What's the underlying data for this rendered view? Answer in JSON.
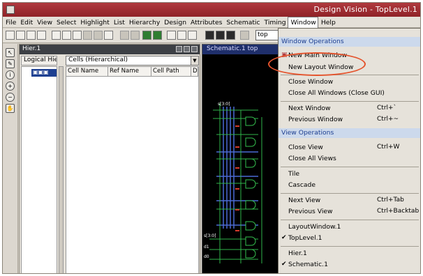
{
  "window": {
    "title": "Design Vision - TopLevel.1"
  },
  "menubar": [
    "File",
    "Edit",
    "View",
    "Select",
    "Highlight",
    "List",
    "Hierarchy",
    "Design",
    "Attributes",
    "Schematic",
    "Timing",
    "Window",
    "Help"
  ],
  "toolbar": {
    "combo_value": "top"
  },
  "hier_panel": {
    "title": "Hier.1",
    "tab_label": "Logical Hie",
    "tree_item": "▣▣▣",
    "cells_dropdown": "Cells (Hierarchical)",
    "columns": [
      "Cell Name",
      "Ref Name",
      "Cell Path",
      "D"
    ]
  },
  "schematic": {
    "title": "Schematic.1  top",
    "labels": {
      "in_a": "s[3:0]",
      "in_b": "d1",
      "in_c": "d0",
      "top_net": "s[3:0]"
    }
  },
  "window_menu": {
    "section_window_ops": "Window Operations",
    "new_main_window": "New Main Window",
    "new_layout_window": "New Layout Window",
    "close_window": "Close Window",
    "close_all_windows": "Close All Windows (Close GUI)",
    "next_window": "Next Window",
    "next_window_accel": "Ctrl+`",
    "previous_window": "Previous Window",
    "previous_window_accel": "Ctrl+~",
    "section_view_ops": "View Operations",
    "close_view": "Close View",
    "close_view_accel": "Ctrl+W",
    "close_all_views": "Close All Views",
    "tile": "Tile",
    "cascade": "Cascade",
    "next_view": "Next View",
    "next_view_accel": "Ctrl+Tab",
    "previous_view": "Previous View",
    "previous_view_accel": "Ctrl+Backtab",
    "layout_window_1": "LayoutWindow.1",
    "toplevel_1": "TopLevel.1",
    "hier_1": "Hier.1",
    "schematic_1": "Schematic.1",
    "check_mark": "✔"
  },
  "annotation": {
    "highlight_color": "#e4532c"
  }
}
